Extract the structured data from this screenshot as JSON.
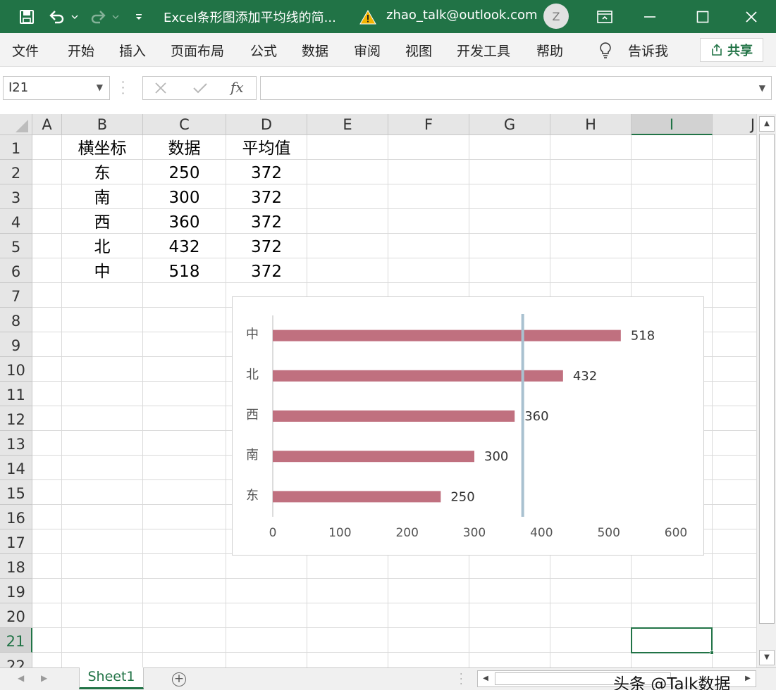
{
  "window": {
    "title": "Excel条形图添加平均线的简...",
    "account": "zhao_talk@outlook.com",
    "avatar_letter": "Z",
    "theme_color": "#217346"
  },
  "ribbon": {
    "tabs": [
      "文件",
      "开始",
      "插入",
      "页面布局",
      "公式",
      "数据",
      "审阅",
      "视图",
      "开发工具",
      "帮助"
    ],
    "tell_me": "告诉我",
    "share": "共享"
  },
  "formula_bar": {
    "name_box": "I21",
    "fx": "fx",
    "formula": ""
  },
  "grid": {
    "columns": [
      "A",
      "B",
      "C",
      "D",
      "E",
      "F",
      "G",
      "H",
      "I",
      "J"
    ],
    "rows": [
      "1",
      "2",
      "3",
      "4",
      "5",
      "6",
      "7",
      "8",
      "9",
      "10",
      "11",
      "12",
      "13",
      "14",
      "15",
      "16",
      "17",
      "18",
      "19",
      "20",
      "21",
      "22"
    ],
    "selected_column": "I",
    "selected_row": "21",
    "cells": {
      "headers": [
        "横坐标",
        "数据",
        "平均值"
      ],
      "table": [
        [
          "东",
          "250",
          "372"
        ],
        [
          "南",
          "300",
          "372"
        ],
        [
          "西",
          "360",
          "372"
        ],
        [
          "北",
          "432",
          "372"
        ],
        [
          "中",
          "518",
          "372"
        ]
      ]
    }
  },
  "chart_data": {
    "type": "bar",
    "orientation": "horizontal",
    "categories": [
      "东",
      "南",
      "西",
      "北",
      "中"
    ],
    "values": [
      250,
      300,
      360,
      432,
      518
    ],
    "data_labels": [
      "250",
      "300",
      "360",
      "432",
      "518"
    ],
    "average_line": 372,
    "xlim": [
      0,
      600
    ],
    "x_ticks": [
      0,
      100,
      200,
      300,
      400,
      500,
      600
    ],
    "x_tick_labels": [
      "0",
      "100",
      "200",
      "300",
      "400",
      "500",
      "600"
    ],
    "bar_color": "#c0707f",
    "average_line_color": "#a9c1d0",
    "grid": false,
    "legend": "none"
  },
  "sheet_tabs": {
    "active": "Sheet1",
    "add_icon": "plus-circle-icon"
  },
  "watermark": "头条 @Talk数据"
}
